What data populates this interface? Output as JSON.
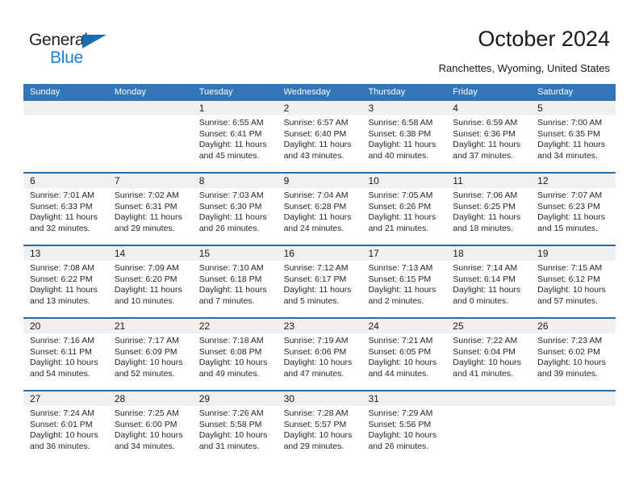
{
  "brand": {
    "name_top": "General",
    "name_bottom": "Blue",
    "triangle_color": "#1b6cb5",
    "text_color": "#231f20",
    "blue_color": "#1b7fd4"
  },
  "header": {
    "title": "October 2024",
    "subtitle": "Ranchettes, Wyoming, United States"
  },
  "theme": {
    "header_bg": "#3275b9",
    "week_divider": "#2c6aab",
    "date_band_bg": "#f0f0f0",
    "cell_bg": "#ffffff"
  },
  "weekdays": [
    "Sunday",
    "Monday",
    "Tuesday",
    "Wednesday",
    "Thursday",
    "Friday",
    "Saturday"
  ],
  "weeks": [
    {
      "days": [
        {
          "num": "",
          "lines": []
        },
        {
          "num": "",
          "lines": []
        },
        {
          "num": "1",
          "lines": [
            "Sunrise: 6:55 AM",
            "Sunset: 6:41 PM",
            "Daylight: 11 hours",
            "and 45 minutes."
          ]
        },
        {
          "num": "2",
          "lines": [
            "Sunrise: 6:57 AM",
            "Sunset: 6:40 PM",
            "Daylight: 11 hours",
            "and 43 minutes."
          ]
        },
        {
          "num": "3",
          "lines": [
            "Sunrise: 6:58 AM",
            "Sunset: 6:38 PM",
            "Daylight: 11 hours",
            "and 40 minutes."
          ]
        },
        {
          "num": "4",
          "lines": [
            "Sunrise: 6:59 AM",
            "Sunset: 6:36 PM",
            "Daylight: 11 hours",
            "and 37 minutes."
          ]
        },
        {
          "num": "5",
          "lines": [
            "Sunrise: 7:00 AM",
            "Sunset: 6:35 PM",
            "Daylight: 11 hours",
            "and 34 minutes."
          ]
        }
      ]
    },
    {
      "days": [
        {
          "num": "6",
          "lines": [
            "Sunrise: 7:01 AM",
            "Sunset: 6:33 PM",
            "Daylight: 11 hours",
            "and 32 minutes."
          ]
        },
        {
          "num": "7",
          "lines": [
            "Sunrise: 7:02 AM",
            "Sunset: 6:31 PM",
            "Daylight: 11 hours",
            "and 29 minutes."
          ]
        },
        {
          "num": "8",
          "lines": [
            "Sunrise: 7:03 AM",
            "Sunset: 6:30 PM",
            "Daylight: 11 hours",
            "and 26 minutes."
          ]
        },
        {
          "num": "9",
          "lines": [
            "Sunrise: 7:04 AM",
            "Sunset: 6:28 PM",
            "Daylight: 11 hours",
            "and 24 minutes."
          ]
        },
        {
          "num": "10",
          "lines": [
            "Sunrise: 7:05 AM",
            "Sunset: 6:26 PM",
            "Daylight: 11 hours",
            "and 21 minutes."
          ]
        },
        {
          "num": "11",
          "lines": [
            "Sunrise: 7:06 AM",
            "Sunset: 6:25 PM",
            "Daylight: 11 hours",
            "and 18 minutes."
          ]
        },
        {
          "num": "12",
          "lines": [
            "Sunrise: 7:07 AM",
            "Sunset: 6:23 PM",
            "Daylight: 11 hours",
            "and 15 minutes."
          ]
        }
      ]
    },
    {
      "days": [
        {
          "num": "13",
          "lines": [
            "Sunrise: 7:08 AM",
            "Sunset: 6:22 PM",
            "Daylight: 11 hours",
            "and 13 minutes."
          ]
        },
        {
          "num": "14",
          "lines": [
            "Sunrise: 7:09 AM",
            "Sunset: 6:20 PM",
            "Daylight: 11 hours",
            "and 10 minutes."
          ]
        },
        {
          "num": "15",
          "lines": [
            "Sunrise: 7:10 AM",
            "Sunset: 6:18 PM",
            "Daylight: 11 hours",
            "and 7 minutes."
          ]
        },
        {
          "num": "16",
          "lines": [
            "Sunrise: 7:12 AM",
            "Sunset: 6:17 PM",
            "Daylight: 11 hours",
            "and 5 minutes."
          ]
        },
        {
          "num": "17",
          "lines": [
            "Sunrise: 7:13 AM",
            "Sunset: 6:15 PM",
            "Daylight: 11 hours",
            "and 2 minutes."
          ]
        },
        {
          "num": "18",
          "lines": [
            "Sunrise: 7:14 AM",
            "Sunset: 6:14 PM",
            "Daylight: 11 hours",
            "and 0 minutes."
          ]
        },
        {
          "num": "19",
          "lines": [
            "Sunrise: 7:15 AM",
            "Sunset: 6:12 PM",
            "Daylight: 10 hours",
            "and 57 minutes."
          ]
        }
      ]
    },
    {
      "days": [
        {
          "num": "20",
          "lines": [
            "Sunrise: 7:16 AM",
            "Sunset: 6:11 PM",
            "Daylight: 10 hours",
            "and 54 minutes."
          ]
        },
        {
          "num": "21",
          "lines": [
            "Sunrise: 7:17 AM",
            "Sunset: 6:09 PM",
            "Daylight: 10 hours",
            "and 52 minutes."
          ]
        },
        {
          "num": "22",
          "lines": [
            "Sunrise: 7:18 AM",
            "Sunset: 6:08 PM",
            "Daylight: 10 hours",
            "and 49 minutes."
          ]
        },
        {
          "num": "23",
          "lines": [
            "Sunrise: 7:19 AM",
            "Sunset: 6:06 PM",
            "Daylight: 10 hours",
            "and 47 minutes."
          ]
        },
        {
          "num": "24",
          "lines": [
            "Sunrise: 7:21 AM",
            "Sunset: 6:05 PM",
            "Daylight: 10 hours",
            "and 44 minutes."
          ]
        },
        {
          "num": "25",
          "lines": [
            "Sunrise: 7:22 AM",
            "Sunset: 6:04 PM",
            "Daylight: 10 hours",
            "and 41 minutes."
          ]
        },
        {
          "num": "26",
          "lines": [
            "Sunrise: 7:23 AM",
            "Sunset: 6:02 PM",
            "Daylight: 10 hours",
            "and 39 minutes."
          ]
        }
      ]
    },
    {
      "days": [
        {
          "num": "27",
          "lines": [
            "Sunrise: 7:24 AM",
            "Sunset: 6:01 PM",
            "Daylight: 10 hours",
            "and 36 minutes."
          ]
        },
        {
          "num": "28",
          "lines": [
            "Sunrise: 7:25 AM",
            "Sunset: 6:00 PM",
            "Daylight: 10 hours",
            "and 34 minutes."
          ]
        },
        {
          "num": "29",
          "lines": [
            "Sunrise: 7:26 AM",
            "Sunset: 5:58 PM",
            "Daylight: 10 hours",
            "and 31 minutes."
          ]
        },
        {
          "num": "30",
          "lines": [
            "Sunrise: 7:28 AM",
            "Sunset: 5:57 PM",
            "Daylight: 10 hours",
            "and 29 minutes."
          ]
        },
        {
          "num": "31",
          "lines": [
            "Sunrise: 7:29 AM",
            "Sunset: 5:56 PM",
            "Daylight: 10 hours",
            "and 26 minutes."
          ]
        },
        {
          "num": "",
          "lines": []
        },
        {
          "num": "",
          "lines": []
        }
      ]
    }
  ]
}
